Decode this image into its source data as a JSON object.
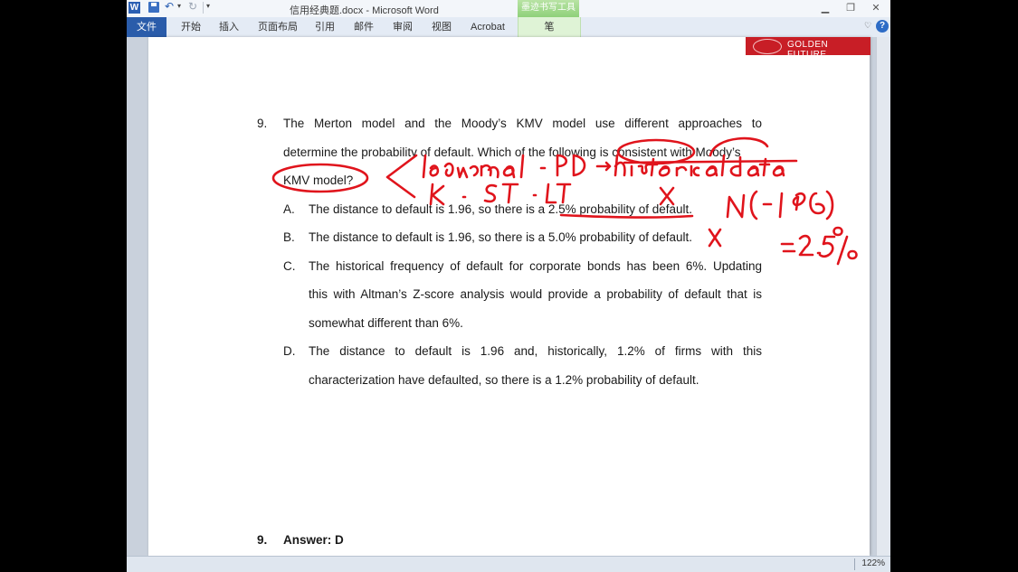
{
  "window": {
    "title": "信用经典题.docx - Microsoft Word",
    "contextual_group": "墨迹书写工具",
    "app_icon": "W"
  },
  "ribbon": {
    "file_tab": "文件",
    "tabs": [
      "开始",
      "插入",
      "页面布局",
      "引用",
      "邮件",
      "审阅",
      "视图",
      "Acrobat"
    ],
    "contextual_tab": "笔"
  },
  "document": {
    "header_logo_text": "GOLDEN FUTURE",
    "question": {
      "number": "9.",
      "lines": [
        "The Merton model and the Moody’s KMV model use different approaches to",
        "determine the probability of default. Which of the following is consistent with Moody’s",
        "KMV model?"
      ]
    },
    "options": [
      {
        "letter": "A.",
        "lines": [
          "The distance to default is 1.96, so there is a 2.5% probability of default."
        ]
      },
      {
        "letter": "B.",
        "lines": [
          "The distance to default is 1.96, so there is a 5.0% probability of default."
        ]
      },
      {
        "letter": "C.",
        "lines": [
          "The historical frequency of default for corporate bonds has been 6%. Updating",
          "this with Altman’s Z-score analysis would provide a probability of default that is",
          "somewhat different than 6%."
        ]
      },
      {
        "letter": "D.",
        "lines": [
          "The distance to default is 1.96 and, historically, 1.2% of firms with this",
          "characterization have defaulted, so there is a 1.2% probability of default."
        ]
      }
    ],
    "answer": {
      "number": "9.",
      "text": "Answer: D"
    }
  },
  "status_bar": {
    "zoom": "122%"
  },
  "colors": {
    "ink": "#e0141c",
    "file_tab": "#2a5caa",
    "logo_band": "#c81e26"
  }
}
